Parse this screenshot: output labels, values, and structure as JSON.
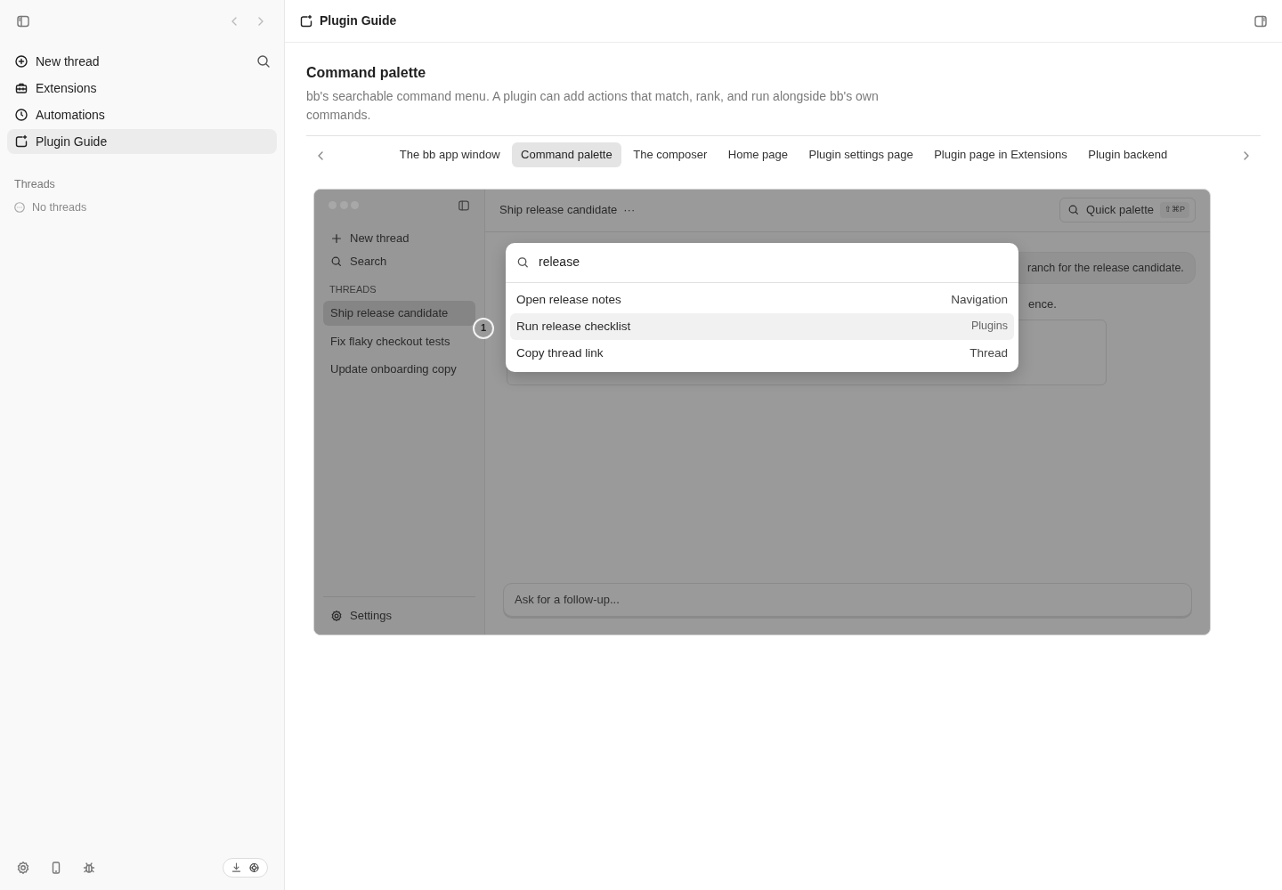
{
  "sidebar": {
    "nav": [
      {
        "label": "New thread",
        "selected": false
      },
      {
        "label": "Extensions",
        "selected": false
      },
      {
        "label": "Automations",
        "selected": false
      },
      {
        "label": "Plugin Guide",
        "selected": true
      }
    ],
    "section_label": "Threads",
    "empty_text": "No threads"
  },
  "header": {
    "title": "Plugin Guide"
  },
  "guide": {
    "title": "Command palette",
    "description": "bb's searchable command menu. A plugin can add actions that match, rank, and run alongside bb's own commands.",
    "tabs": [
      {
        "label": "The bb app window",
        "selected": false
      },
      {
        "label": "Command palette",
        "selected": true
      },
      {
        "label": "The composer",
        "selected": false
      },
      {
        "label": "Home page",
        "selected": false
      },
      {
        "label": "Plugin settings page",
        "selected": false
      },
      {
        "label": "Plugin page in Extensions",
        "selected": false
      },
      {
        "label": "Plugin backend",
        "selected": false
      }
    ]
  },
  "mock": {
    "nav": [
      "New thread",
      "Search"
    ],
    "section_label": "THREADS",
    "threads": [
      {
        "label": "Ship release candidate",
        "selected": true
      },
      {
        "label": "Fix flaky checkout tests",
        "selected": false
      },
      {
        "label": "Update onboarding copy",
        "selected": false
      }
    ],
    "settings": "Settings",
    "title": "Ship release candidate",
    "more": "···",
    "quick_palette": {
      "label": "Quick palette",
      "shortcut": "⇧⌘P"
    },
    "messages": [
      "ranch for the release candidate.",
      "ence."
    ],
    "composer": {
      "placeholder": "Ask for a follow-up..."
    },
    "palette": {
      "query": "release",
      "results": [
        {
          "label": "Open release notes",
          "category": "Navigation",
          "selected": false
        },
        {
          "label": "Run release checklist",
          "category": "Plugins",
          "selected": true
        },
        {
          "label": "Copy thread link",
          "category": "Thread",
          "selected": false
        }
      ],
      "badge": "1"
    }
  }
}
